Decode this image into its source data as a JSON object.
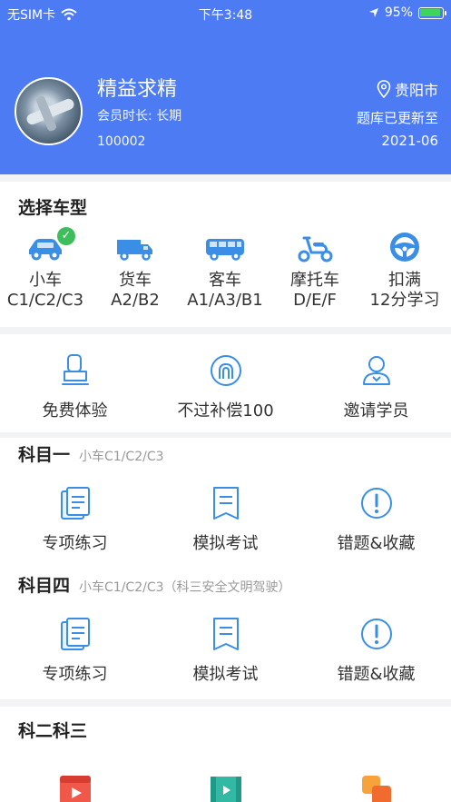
{
  "status": {
    "carrier": "无SIM卡",
    "time": "下午3:48",
    "battery": "95%"
  },
  "profile": {
    "name": "精益求精",
    "member": "会员时长: 长期",
    "id": "100002",
    "city": "贵阳市",
    "update_label": "题库已更新至",
    "update_date": "2021-06"
  },
  "vehicle": {
    "title": "选择车型",
    "items": [
      {
        "name": "小车",
        "sub": "C1/C2/C3",
        "icon": "car-icon",
        "selected": true
      },
      {
        "name": "货车",
        "sub": "A2/B2",
        "icon": "truck-icon"
      },
      {
        "name": "客车",
        "sub": "A1/A3/B1",
        "icon": "bus-icon"
      },
      {
        "name": "摩托车",
        "sub": "D/E/F",
        "icon": "motorcycle-icon"
      },
      {
        "name": "扣满",
        "sub": "12分学习",
        "icon": "steering-wheel-icon"
      }
    ]
  },
  "promo": [
    {
      "label": "免费体验",
      "icon": "seat-icon"
    },
    {
      "label": "不过补偿100",
      "icon": "guarantee-icon"
    },
    {
      "label": "邀请学员",
      "icon": "user-icon"
    }
  ],
  "subject1": {
    "title": "科目一",
    "sub": "小车C1/C2/C3",
    "items": [
      "专项练习",
      "模拟考试",
      "错题&收藏"
    ]
  },
  "subject4": {
    "title": "科目四",
    "sub": "小车C1/C2/C3（科三安全文明驾驶）",
    "items": [
      "专项练习",
      "模拟考试",
      "错题&收藏"
    ]
  },
  "subject23": {
    "title": "科二科三",
    "icons": [
      "video-icon",
      "film-icon",
      "layers-icon"
    ]
  },
  "colors": {
    "header": "#4d7bf3",
    "accent": "#3a8ee6",
    "check": "#3dbd5b"
  }
}
